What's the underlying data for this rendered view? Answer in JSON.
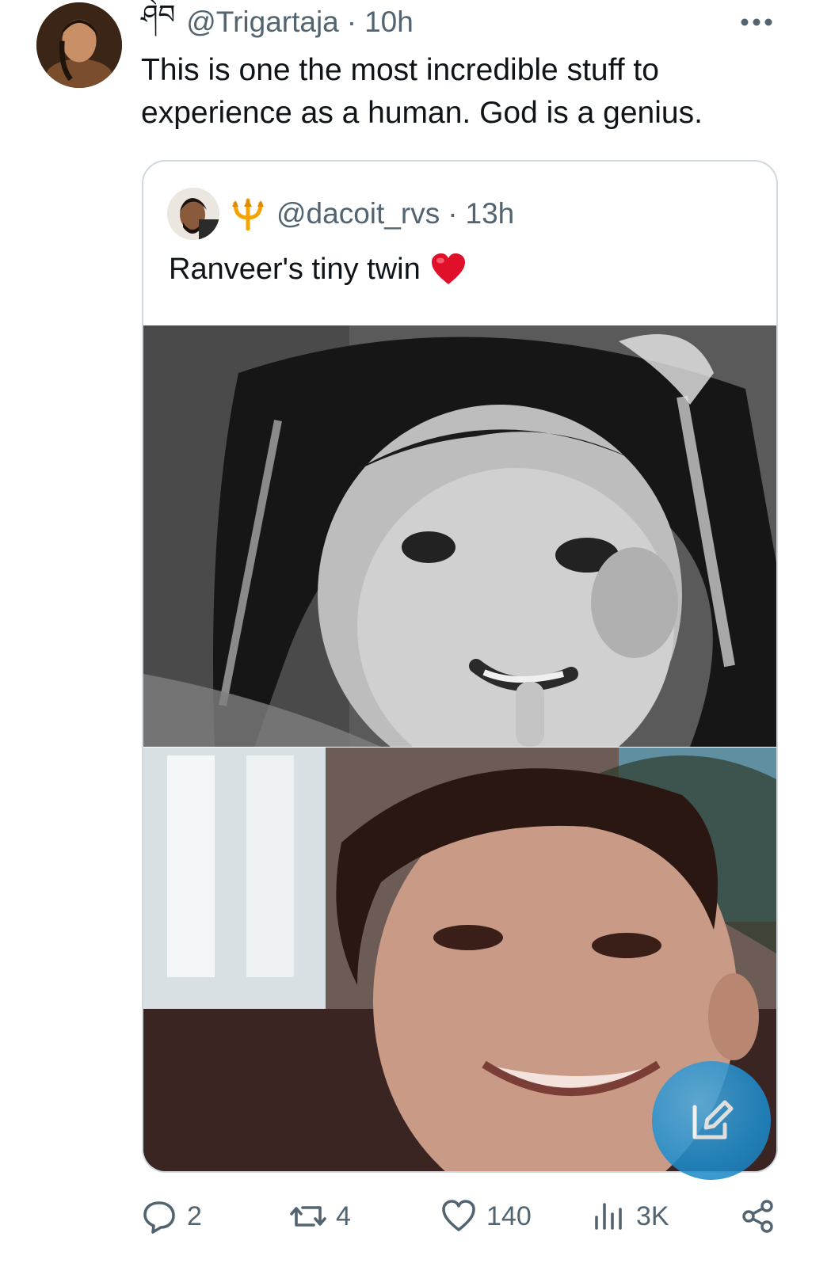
{
  "tweet": {
    "name_glyph": "ཤེབ",
    "handle": "@Trigartaja",
    "separator": "·",
    "time": "10h",
    "text": "This is one the most incredible stuff to experience as a human. God is a genius."
  },
  "quoted_tweet": {
    "handle": "@dacoit_rvs",
    "separator": "·",
    "time": "13h",
    "text": "Ranveer's tiny twin",
    "icons": {
      "name_emoji": "trident-icon",
      "text_emoji": "heart-icon"
    }
  },
  "actions": {
    "replies": "2",
    "retweets": "4",
    "likes": "140",
    "views": "3K"
  },
  "colors": {
    "text": "#0f1419",
    "muted": "#536471",
    "border": "#cfd9de",
    "accent": "#1d9bf0",
    "heart_red": "#e0102a",
    "trident_gold": "#f4a300"
  }
}
